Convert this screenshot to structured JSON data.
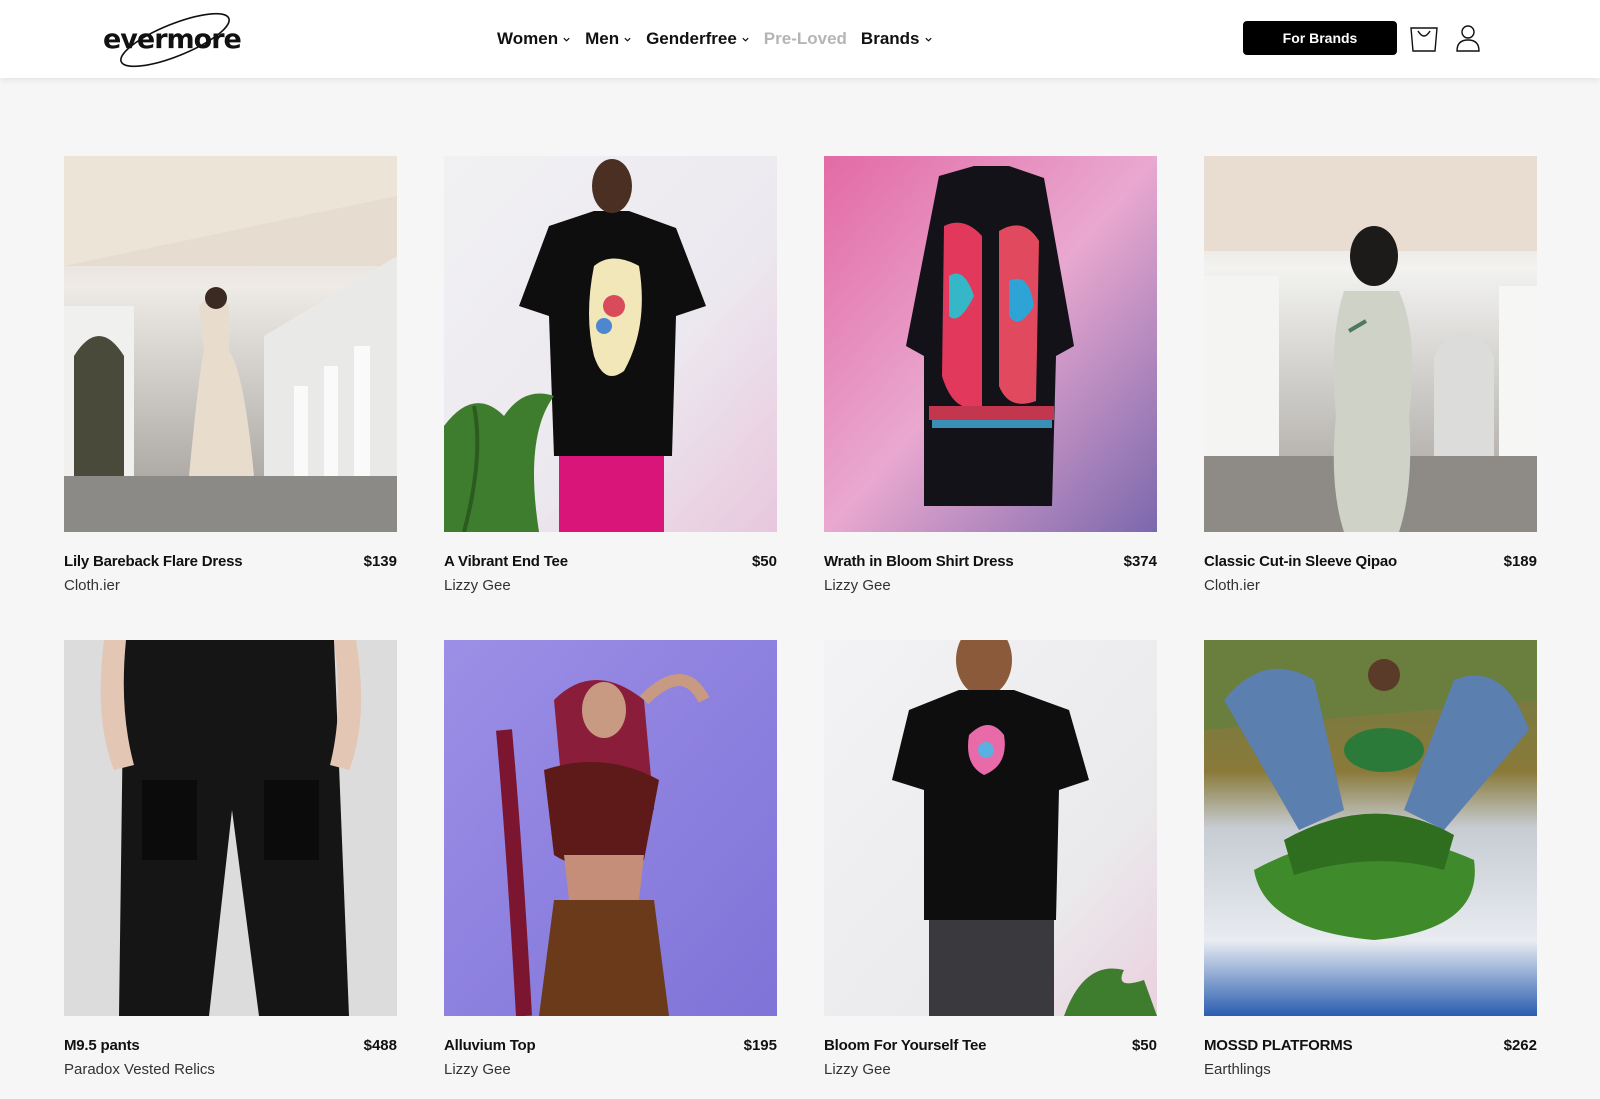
{
  "header": {
    "logo": "evermore",
    "nav": [
      {
        "label": "Women",
        "dropdown": true
      },
      {
        "label": "Men",
        "dropdown": true
      },
      {
        "label": "Genderfree",
        "dropdown": true
      },
      {
        "label": "Pre-Loved",
        "dropdown": false,
        "muted": true
      },
      {
        "label": "Brands",
        "dropdown": true
      }
    ],
    "cta_label": "For Brands",
    "icons": [
      "shopping-bag-icon",
      "user-icon"
    ]
  },
  "products": [
    {
      "name": "Lily Bareback Flare Dress",
      "price": "$139",
      "brand": "Cloth.ier"
    },
    {
      "name": "A Vibrant End Tee",
      "price": "$50",
      "brand": "Lizzy Gee"
    },
    {
      "name": "Wrath in Bloom Shirt Dress",
      "price": "$374",
      "brand": "Lizzy Gee"
    },
    {
      "name": "Classic Cut-in Sleeve Qipao",
      "price": "$189",
      "brand": "Cloth.ier"
    },
    {
      "name": "M9.5 pants",
      "price": "$488",
      "brand": "Paradox Vested Relics"
    },
    {
      "name": "Alluvium Top",
      "price": "$195",
      "brand": "Lizzy Gee"
    },
    {
      "name": "Bloom For Yourself Tee",
      "price": "$50",
      "brand": "Lizzy Gee"
    },
    {
      "name": "MOSSD PLATFORMS",
      "price": "$262",
      "brand": "Earthlings"
    }
  ],
  "colors": {
    "accent": "#000000",
    "muted_nav": "#b5b5b5",
    "page_bg": "#f6f6f6"
  }
}
